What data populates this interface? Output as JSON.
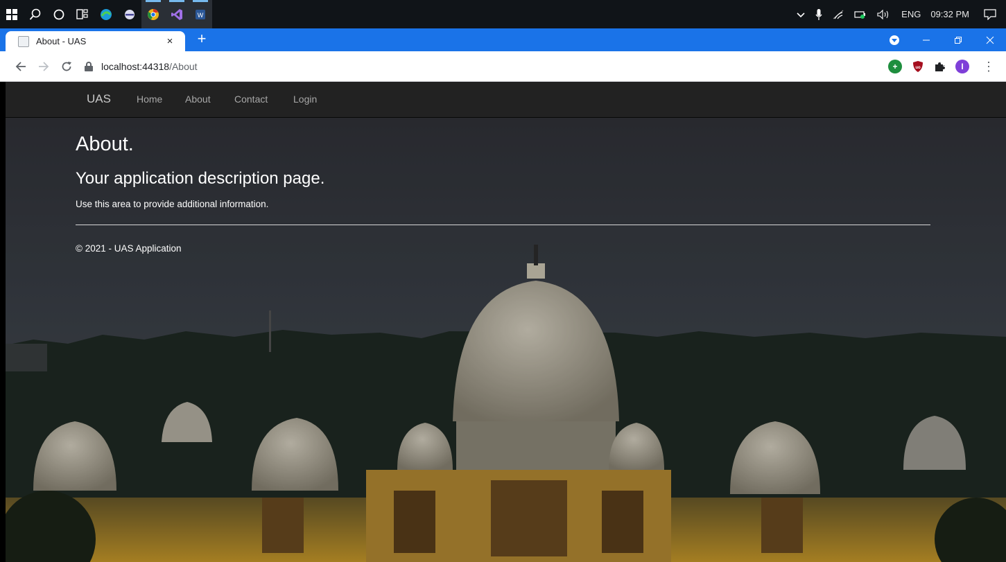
{
  "taskbar": {
    "tray": {
      "language": "ENG",
      "time": "09:32 PM"
    }
  },
  "browser": {
    "tab": {
      "title": "About - UAS",
      "close_glyph": "×"
    },
    "new_tab_glyph": "+",
    "address": {
      "host": "localhost:44318",
      "path": "/About"
    },
    "extension_avatar_letter": "I",
    "colors": {
      "tab_strip": "#1a73e8",
      "toolbar": "#ffffff"
    }
  },
  "site": {
    "brand": "UAS",
    "nav": [
      "Home",
      "About",
      "Contact",
      "Login"
    ],
    "heading": "About.",
    "subheading": "Your application description page.",
    "paragraph": "Use this area to provide additional information.",
    "footer": "© 2021 - UAS Application",
    "colors": {
      "navbar": "#222222",
      "text": "#ffffff"
    }
  },
  "icons": {
    "taskbar": [
      "windows-start-icon",
      "search-icon",
      "cortana-icon",
      "task-view-icon",
      "edge-icon",
      "app-icon",
      "chrome-icon",
      "visual-studio-icon",
      "word-icon"
    ],
    "tray": [
      "chevron-up-icon",
      "microphone-icon",
      "wifi-icon",
      "battery-icon",
      "volume-icon",
      "notification-icon"
    ],
    "extensions": [
      "green-plus-extension-icon",
      "ublock-shield-icon",
      "puzzle-extensions-icon",
      "profile-avatar-icon"
    ]
  }
}
